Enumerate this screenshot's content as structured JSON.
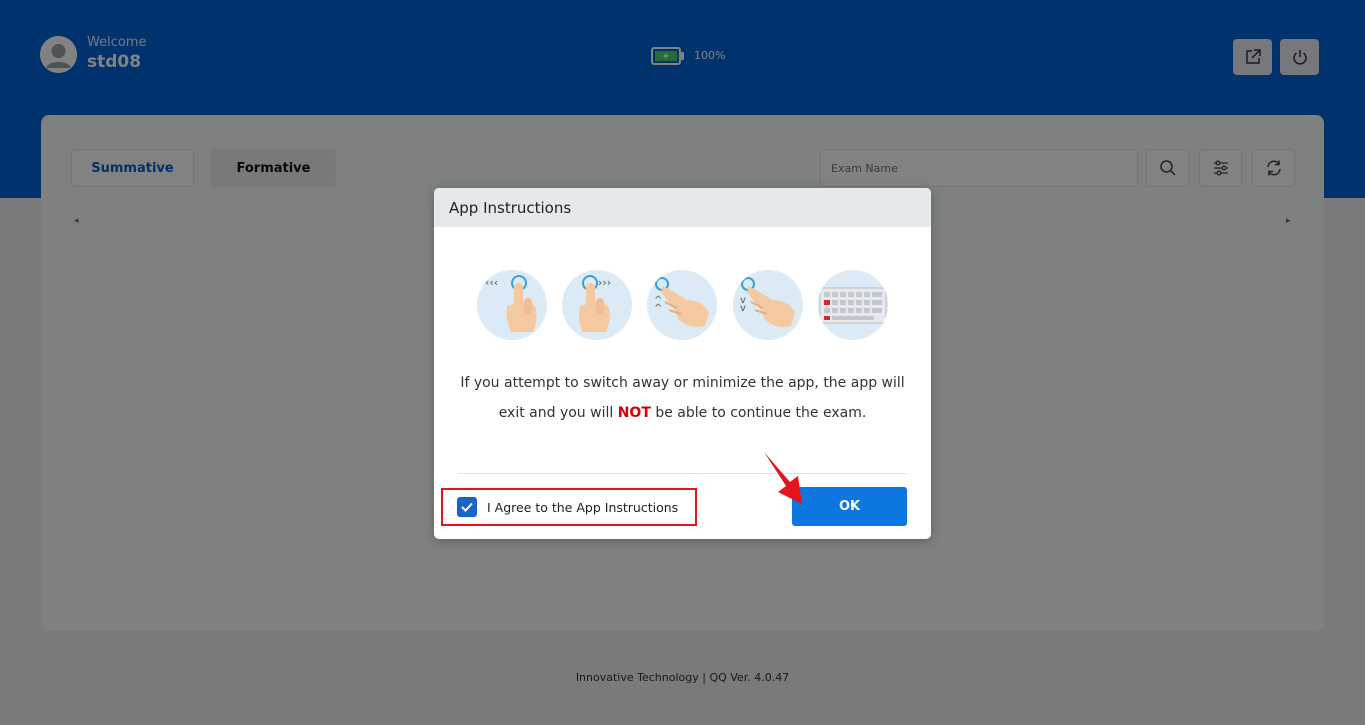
{
  "header": {
    "welcome": "Welcome",
    "username": "std08",
    "battery": "100%",
    "icons": [
      "user-avatar-icon",
      "battery-icon",
      "external-link-icon",
      "power-icon"
    ]
  },
  "tabs": {
    "summative": "Summative",
    "formative": "Formative"
  },
  "search": {
    "placeholder": "Exam Name"
  },
  "toolbar_icons": [
    "search-icon",
    "filter-icon",
    "refresh-icon"
  ],
  "footer": {
    "text": "Innovative Technology | QQ Ver. 4.0.47"
  },
  "modal": {
    "title": "App Instructions",
    "gestures": [
      "swipe-left-icon",
      "swipe-right-icon",
      "swipe-up-icon",
      "swipe-down-icon",
      "keyboard-icon"
    ],
    "message_part1": "If you attempt to switch away or minimize the app, the app will",
    "message_part2": "exit and you will",
    "message_not": "NOT",
    "message_part3": "be able to continue the exam.",
    "checkbox_label": "I Agree to the App Instructions",
    "checkbox_checked": true,
    "ok_label": "OK"
  },
  "colors": {
    "header": "#0064d6",
    "accent": "#0d76e0",
    "warning": "#d60000",
    "highlight": "#e3151a"
  }
}
